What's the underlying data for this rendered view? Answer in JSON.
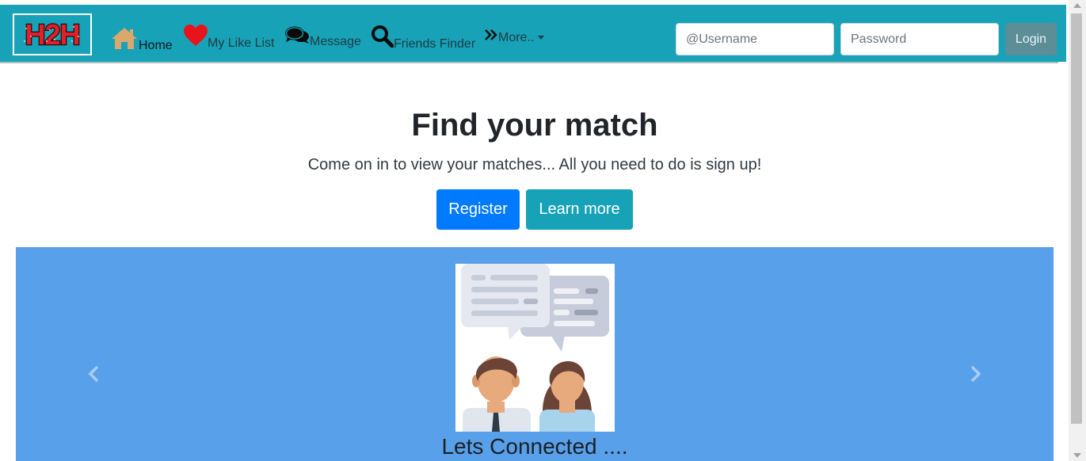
{
  "nav": {
    "logo_text": "H2H",
    "home": "Home",
    "like_list": "My Like List",
    "message": "Message",
    "friends_finder": "Friends Finder",
    "more": "More.."
  },
  "login": {
    "username_placeholder": "@Username",
    "password_placeholder": "Password",
    "button": "Login"
  },
  "hero": {
    "title": "Find your match",
    "subtitle": "Come on in to view your matches... All you need to do is sign up!",
    "register": "Register",
    "learn_more": "Learn more"
  },
  "carousel": {
    "caption": "Lets Connected ...."
  },
  "colors": {
    "navbar": "#17a2b8",
    "register": "#007bff",
    "learn_more": "#17a2b8",
    "carousel_bg": "#58a0e9",
    "login_button": "#5c8e98"
  },
  "icons": [
    "home-icon",
    "heart-icon",
    "comments-icon",
    "search-icon",
    "angle-double-right-icon",
    "caret-down-icon",
    "chevron-left-icon",
    "chevron-right-icon"
  ]
}
